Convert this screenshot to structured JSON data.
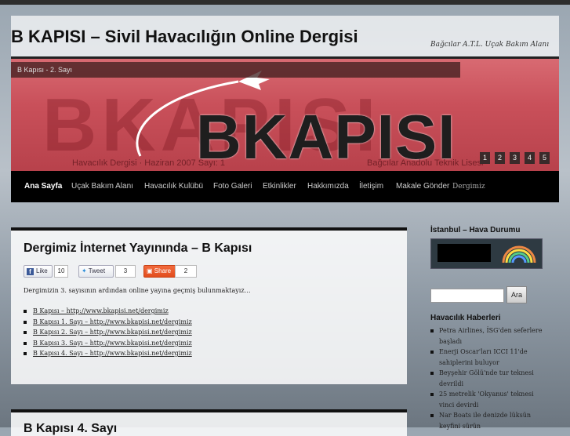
{
  "site": {
    "title": "B KAPISI – Sivil Havacılığın Online Dergisi",
    "tagline": "Bağcılar A.T.L. Uçak Bakım Alanı"
  },
  "banner": {
    "caption": "B Kapısı - 2. Sayı",
    "logo_text": "BKAPISI",
    "ghost_text": "BKAPISI",
    "left_subtitle": "Havacılık Dergisi · Haziran 2007 Sayı: 1",
    "right_subtitle": "Bağcılar Anadolu Teknik Lisesi",
    "pages": [
      "1",
      "2",
      "3",
      "4",
      "5"
    ],
    "colors": {
      "background": "#c9505a"
    }
  },
  "nav": {
    "items": [
      "Ana Sayfa",
      "Uçak Bakım Alanı",
      "Havacılık Kulübü",
      "Foto Galeri",
      "Etkinlikler",
      "Hakkımızda",
      "İletişim",
      "Makale Gönder"
    ],
    "tail": "Dergimiz",
    "active_index": 0
  },
  "post": {
    "title": "Dergimiz İnternet Yayınında – B Kapısı",
    "social": {
      "like_label": "Like",
      "like_count": "10",
      "tweet_label": "Tweet",
      "tweet_count": "3",
      "share_label": "Share",
      "share_count": "2"
    },
    "intro": "Dergimizin 3. sayısının ardından online yayına geçmiş bulunmaktayız…",
    "links": [
      "B Kapısı – http://www.bkapisi.net/dergimiz",
      "B Kapısı 1. Sayı – http://www.bkapisi.net/dergimiz",
      "B Kapısı 2. Sayı – http://www.bkapisi.net/dergimiz",
      "B Kapısı 3. Sayı – http://www.bkapisi.net/dergimiz",
      "B Kapısı 4. Sayı – http://www.bkapisi.net/dergimiz"
    ]
  },
  "post2": {
    "title": "B Kapısı 4. Sayı"
  },
  "sidebar": {
    "weather_title": "İstanbul – Hava Durumu",
    "search_button": "Ara",
    "news_title": "Havacılık Haberleri",
    "news": [
      "Petra Airlines, İSG'den seferlere başladı",
      "Enerji Oscar'ları ICCI 11'de sahiplerini buluyor",
      "Beyşehir Gölü'nde tur teknesi devrildi",
      "25 metrelik 'Okyanus' teknesi vinci devirdi",
      "Nar Boats ile denizde lüksün keyfini sürün"
    ]
  }
}
